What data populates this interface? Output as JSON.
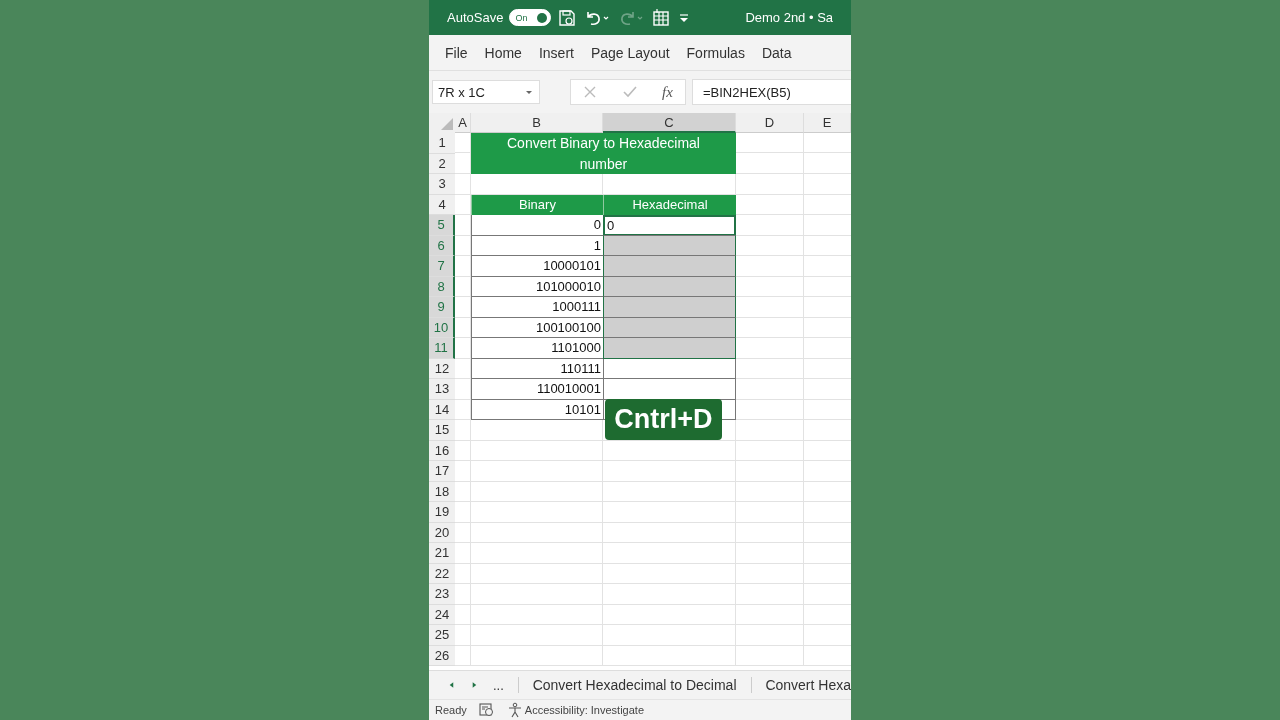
{
  "title_bar": {
    "autosave_label": "AutoSave",
    "autosave_toggle": {
      "label": "On",
      "on": true
    },
    "redo_disabled": true,
    "document_title": "Demo 2nd • Sa"
  },
  "ribbon_tabs": [
    "File",
    "Home",
    "Insert",
    "Page Layout",
    "Formulas",
    "Data"
  ],
  "formula_bar": {
    "name_box": "7R x 1C",
    "fx": "fx",
    "formula": "=BIN2HEX(B5)"
  },
  "columns": [
    {
      "label": "A",
      "selected": false
    },
    {
      "label": "B",
      "selected": false
    },
    {
      "label": "C",
      "selected": true
    },
    {
      "label": "D",
      "selected": false
    },
    {
      "label": "E",
      "selected": false
    }
  ],
  "rows": [
    {
      "number": "1",
      "selected": false
    },
    {
      "number": "2",
      "selected": false
    },
    {
      "number": "3",
      "selected": false
    },
    {
      "number": "4",
      "selected": false
    },
    {
      "number": "5",
      "selected": true
    },
    {
      "number": "6",
      "selected": true
    },
    {
      "number": "7",
      "selected": true
    },
    {
      "number": "8",
      "selected": true
    },
    {
      "number": "9",
      "selected": true
    },
    {
      "number": "10",
      "selected": true
    },
    {
      "number": "11",
      "selected": true
    },
    {
      "number": "12",
      "selected": false
    },
    {
      "number": "13",
      "selected": false
    },
    {
      "number": "14",
      "selected": false
    },
    {
      "number": "15",
      "selected": false
    },
    {
      "number": "16",
      "selected": false
    },
    {
      "number": "17",
      "selected": false
    },
    {
      "number": "18",
      "selected": false
    },
    {
      "number": "19",
      "selected": false
    },
    {
      "number": "20",
      "selected": false
    },
    {
      "number": "21",
      "selected": false
    },
    {
      "number": "22",
      "selected": false
    },
    {
      "number": "23",
      "selected": false
    },
    {
      "number": "24",
      "selected": false
    },
    {
      "number": "25",
      "selected": false
    },
    {
      "number": "26",
      "selected": false
    }
  ],
  "sheet": {
    "title": "Convert Binary to Hexadecimal number",
    "headers": [
      "Binary",
      "Hexadecimal"
    ],
    "data": [
      {
        "binary": "0",
        "hex": "0",
        "selected": true,
        "active": true
      },
      {
        "binary": "1",
        "selected": true,
        "active": false
      },
      {
        "binary": "10000101",
        "selected": true,
        "active": false
      },
      {
        "binary": "101000010",
        "selected": true,
        "active": false
      },
      {
        "binary": "1000111",
        "selected": true,
        "active": false
      },
      {
        "binary": "100100100",
        "selected": true,
        "active": false
      },
      {
        "binary": "1101000",
        "selected": true,
        "active": false
      },
      {
        "binary": "110111",
        "selected": false,
        "active": false
      },
      {
        "binary": "110010001",
        "selected": false,
        "active": false
      },
      {
        "binary": "10101",
        "selected": false,
        "active": false
      }
    ]
  },
  "overlay_caption": "Cntrl+D",
  "sheet_tabs": {
    "more": "...",
    "tabs": [
      "Convert Hexadecimal to Decimal",
      "Convert Hexa"
    ]
  },
  "status_bar": {
    "ready": "Ready",
    "accessibility": "Accessibility: Investigate"
  }
}
